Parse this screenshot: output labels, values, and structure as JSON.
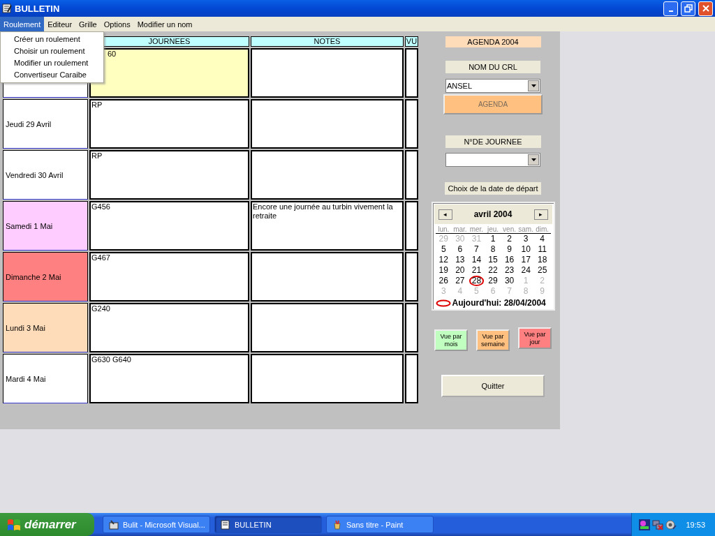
{
  "window": {
    "title": "BULLETIN"
  },
  "menu_bar": [
    {
      "label": "Roulement",
      "selected": true
    },
    {
      "label": "Editeur",
      "selected": false
    },
    {
      "label": "Grille",
      "selected": false
    },
    {
      "label": "Options",
      "selected": false
    },
    {
      "label": "Modifier un nom",
      "selected": false
    }
  ],
  "dropdown": [
    "Créer un roulement",
    "Choisir un roulement",
    "Modifier un roulement",
    "Convertiseur Caraibe"
  ],
  "table": {
    "columns": [
      "JOURNEES",
      "NOTES",
      "VU"
    ],
    "rows": [
      {
        "date": {
          "color": "#ffffff"
        },
        "journee": {
          "text": "60",
          "color": "#ffffc0"
        },
        "note": ""
      },
      {
        "date": {
          "text": "Jeudi 29 Avril",
          "color": "#ffffff"
        },
        "journee": {
          "text": "RP",
          "color": "#ffffff"
        },
        "note": ""
      },
      {
        "date": {
          "text": "Vendredi 30 Avril",
          "color": "#ffffff"
        },
        "journee": {
          "text": "RP",
          "color": "#ffffff"
        },
        "note": ""
      },
      {
        "date": {
          "text": "Samedi 1 Mai",
          "color": "#ffccff"
        },
        "journee": {
          "text": "G456",
          "color": "#ffffff"
        },
        "note": "Encore une journée au turbin vivement la retraite"
      },
      {
        "date": {
          "text": "Dimanche 2 Mai",
          "color": "#ff8080"
        },
        "journee": {
          "text": "G467",
          "color": "#ffffff"
        },
        "note": ""
      },
      {
        "date": {
          "text": "Lundi 3 Mai",
          "color": "#ffdcb9"
        },
        "journee": {
          "text": "G240",
          "color": "#ffffff"
        },
        "note": ""
      },
      {
        "date": {
          "text": "Mardi 4 Mai",
          "color": "#ffffff"
        },
        "journee": {
          "text": "G630 G640",
          "color": "#ffffff"
        },
        "note": ""
      }
    ]
  },
  "side": {
    "agenda_title": "AGENDA 2004",
    "crl_label": "NOM DU CRL",
    "crl_value": "ANSEL",
    "agenda_button": {
      "label": "AGENDA",
      "disabled": true
    },
    "journee_label": "N°DE JOURNEE",
    "date_label": "Choix de la date de départ"
  },
  "calendar": {
    "prev": "◂",
    "next": "▸",
    "month": "avril 2004",
    "weekdays": [
      "lun.",
      "mar.",
      "mer.",
      "jeu.",
      "ven.",
      "sam.",
      "dim."
    ],
    "days": [
      {
        "d": "29",
        "muted": true,
        "selected": false
      },
      {
        "d": "30",
        "muted": true,
        "selected": false
      },
      {
        "d": "31",
        "muted": true,
        "selected": false
      },
      {
        "d": "1",
        "muted": false,
        "selected": false
      },
      {
        "d": "2",
        "muted": false,
        "selected": false
      },
      {
        "d": "3",
        "muted": false,
        "selected": false
      },
      {
        "d": "4",
        "muted": false,
        "selected": false
      },
      {
        "d": "5",
        "muted": false,
        "selected": false
      },
      {
        "d": "6",
        "muted": false,
        "selected": false
      },
      {
        "d": "7",
        "muted": false,
        "selected": false
      },
      {
        "d": "8",
        "muted": false,
        "selected": false
      },
      {
        "d": "9",
        "muted": false,
        "selected": false
      },
      {
        "d": "10",
        "muted": false,
        "selected": false
      },
      {
        "d": "11",
        "muted": false,
        "selected": false
      },
      {
        "d": "12",
        "muted": false,
        "selected": false
      },
      {
        "d": "13",
        "muted": false,
        "selected": false
      },
      {
        "d": "14",
        "muted": false,
        "selected": false
      },
      {
        "d": "15",
        "muted": false,
        "selected": false
      },
      {
        "d": "16",
        "muted": false,
        "selected": false
      },
      {
        "d": "17",
        "muted": false,
        "selected": false
      },
      {
        "d": "18",
        "muted": false,
        "selected": false
      },
      {
        "d": "19",
        "muted": false,
        "selected": false
      },
      {
        "d": "20",
        "muted": false,
        "selected": false
      },
      {
        "d": "21",
        "muted": false,
        "selected": false
      },
      {
        "d": "22",
        "muted": false,
        "selected": false
      },
      {
        "d": "23",
        "muted": false,
        "selected": false
      },
      {
        "d": "24",
        "muted": false,
        "selected": false
      },
      {
        "d": "25",
        "muted": false,
        "selected": false
      },
      {
        "d": "26",
        "muted": false,
        "selected": false
      },
      {
        "d": "27",
        "muted": false,
        "selected": false
      },
      {
        "d": "28",
        "muted": false,
        "selected": true
      },
      {
        "d": "29",
        "muted": false,
        "selected": false
      },
      {
        "d": "30",
        "muted": false,
        "selected": false
      },
      {
        "d": "1",
        "muted": true,
        "selected": false
      },
      {
        "d": "2",
        "muted": true,
        "selected": false
      },
      {
        "d": "3",
        "muted": true,
        "selected": false
      },
      {
        "d": "4",
        "muted": true,
        "selected": false
      },
      {
        "d": "5",
        "muted": true,
        "selected": false
      },
      {
        "d": "6",
        "muted": true,
        "selected": false
      },
      {
        "d": "7",
        "muted": true,
        "selected": false
      },
      {
        "d": "8",
        "muted": true,
        "selected": false
      },
      {
        "d": "9",
        "muted": true,
        "selected": false
      }
    ],
    "today": "Aujourd'hui: 28/04/2004"
  },
  "view_buttons": [
    {
      "label": "Vue par mois",
      "color": "#c0ffc0"
    },
    {
      "label": "Vue par semaine",
      "color": "#ffc080"
    },
    {
      "label": "Vue par jour",
      "color": "#ff8080"
    }
  ],
  "quit_button": "Quitter",
  "taskbar": {
    "start": "démarrer",
    "tasks": [
      {
        "label": "Bulit - Microsoft Visual...",
        "selected": false
      },
      {
        "label": "BULLETIN",
        "selected": true
      },
      {
        "label": "Sans titre - Paint",
        "selected": false
      }
    ],
    "clock": "19:53"
  }
}
